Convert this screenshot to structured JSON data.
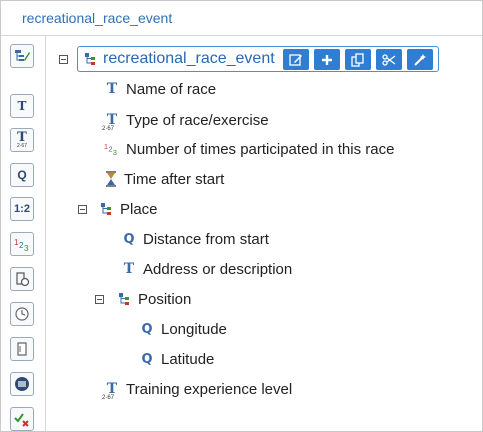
{
  "window": {
    "title": "recreational_race_event"
  },
  "toolbar": {
    "buttons": [
      {
        "name": "edit-tree-button",
        "glyph": ""
      },
      {
        "name": "text-field-button",
        "glyph": "T"
      },
      {
        "name": "text-number-field-button",
        "glyph": "T"
      },
      {
        "name": "quantity-field-button",
        "glyph": "Q"
      },
      {
        "name": "ratio-field-button",
        "glyph": "1:2"
      },
      {
        "name": "count-field-button",
        "glyph": "123"
      },
      {
        "name": "duration-field-button",
        "glyph": ""
      },
      {
        "name": "time-field-button",
        "glyph": ""
      },
      {
        "name": "document-field-button",
        "glyph": ""
      },
      {
        "name": "list-field-button",
        "glyph": ""
      },
      {
        "name": "boolean-field-button",
        "glyph": ""
      }
    ]
  },
  "tree": {
    "root": {
      "label": "recreational_race_event"
    },
    "nodes": [
      {
        "id": "name_of_race",
        "label": "Name of race",
        "icon": "text-icon"
      },
      {
        "id": "type_of_race",
        "label": "Type of race/exercise",
        "icon": "coded-text-icon"
      },
      {
        "id": "times_participated",
        "label": "Number of times participated in this race",
        "icon": "count-icon"
      },
      {
        "id": "time_after_start",
        "label": "Time after start",
        "icon": "duration-icon"
      },
      {
        "id": "place",
        "label": "Place",
        "icon": "cluster-icon"
      },
      {
        "id": "distance_from_start",
        "label": "Distance from start",
        "icon": "quantity-icon"
      },
      {
        "id": "address",
        "label": "Address or description",
        "icon": "text-icon"
      },
      {
        "id": "position",
        "label": "Position",
        "icon": "cluster-icon"
      },
      {
        "id": "longitude",
        "label": "Longitude",
        "icon": "quantity-icon"
      },
      {
        "id": "latitude",
        "label": "Latitude",
        "icon": "quantity-icon"
      },
      {
        "id": "training_level",
        "label": "Training experience level",
        "icon": "coded-text-icon"
      }
    ]
  },
  "root_actions": [
    {
      "name": "edit-button",
      "icon": "edit-icon"
    },
    {
      "name": "add-button",
      "icon": "plus-icon"
    },
    {
      "name": "copy-button",
      "icon": "copy-icon"
    },
    {
      "name": "cut-button",
      "icon": "scissors-icon"
    },
    {
      "name": "magic-button",
      "icon": "magic-wand-icon"
    }
  ],
  "colors": {
    "accent": "#2f7ed1",
    "icon_blue": "#3a6aa8",
    "title_blue": "#2f6fb5"
  }
}
